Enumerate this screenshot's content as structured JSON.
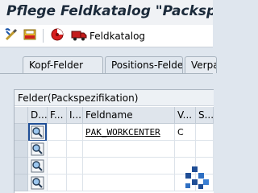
{
  "window": {
    "title": "Pflege Feldkatalog \"Packspezifikation\""
  },
  "toolbar": {
    "buttons": [
      {
        "icon": "display-change-icon"
      },
      {
        "icon": "save-local-icon"
      },
      {
        "icon": "other-object-icon"
      },
      {
        "icon": "truck-icon",
        "label": "Feldkatalog"
      }
    ]
  },
  "tabs": [
    {
      "label": "Kopf-Felder",
      "active": false
    },
    {
      "label": "Positions-Felder",
      "active": true
    },
    {
      "label": "Verpackung",
      "active": false
    }
  ],
  "panel": {
    "title": "Felder(Packspezifikation)"
  },
  "table": {
    "columns": [
      "D...",
      "F...",
      "I...",
      "Feldname",
      "V...",
      "S..."
    ],
    "rows": [
      {
        "icon": "detail-icon",
        "selected": true,
        "f": "",
        "i": "",
        "feldname": "PAK_WORKCENTER",
        "v": "C",
        "s": ""
      },
      {
        "icon": "detail-icon",
        "selected": false,
        "f": "",
        "i": "",
        "feldname": "",
        "v": "",
        "s": ""
      },
      {
        "icon": "detail-icon",
        "selected": false,
        "f": "",
        "i": "",
        "feldname": "",
        "v": "",
        "s": ""
      },
      {
        "icon": "detail-icon",
        "selected": false,
        "f": "",
        "i": "",
        "feldname": "",
        "v": "",
        "s": ""
      }
    ]
  },
  "colors": {
    "selection_outline": "#1f4e96",
    "logo": "#1f4e96"
  }
}
